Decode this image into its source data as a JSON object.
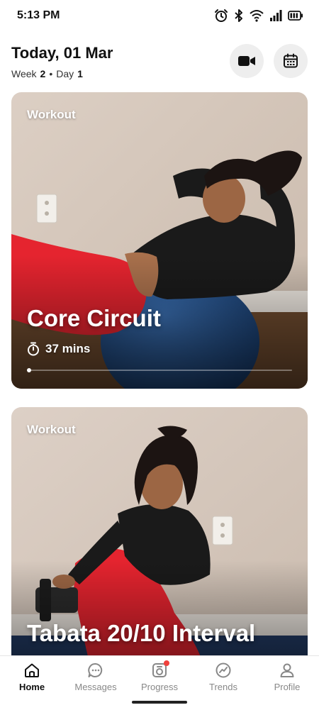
{
  "status_bar": {
    "time": "5:13 PM",
    "icons": [
      "alarm-icon",
      "bluetooth-icon",
      "wifi-icon",
      "signal-icon",
      "battery-icon"
    ]
  },
  "header": {
    "date_title": "Today, 01 Mar",
    "week_label": "Week",
    "week_number": "2",
    "separator": "•",
    "day_label": "Day",
    "day_number": "1",
    "video_button_icon": "video-camera-icon",
    "calendar_button_icon": "calendar-icon"
  },
  "cards": [
    {
      "tag": "Workout",
      "title": "Core Circuit",
      "duration": "37 mins",
      "duration_icon": "stopwatch-icon",
      "progress": 0
    },
    {
      "tag": "Workout",
      "title": "Tabata 20/10 Interval"
    }
  ],
  "bottom_nav": {
    "items": [
      {
        "label": "Home",
        "icon": "home-icon",
        "active": true
      },
      {
        "label": "Messages",
        "icon": "chat-icon",
        "active": false
      },
      {
        "label": "Progress",
        "icon": "progress-icon",
        "active": false,
        "notification": true
      },
      {
        "label": "Trends",
        "icon": "trends-icon",
        "active": false
      },
      {
        "label": "Profile",
        "icon": "profile-icon",
        "active": false
      }
    ]
  },
  "colors": {
    "accent_red": "#f0413c",
    "card_wall": "#d8cabf",
    "ball_blue": "#1f4d86",
    "leggings_red": "#e5242f",
    "active_nav": "#111111",
    "inactive_nav": "#888888"
  }
}
